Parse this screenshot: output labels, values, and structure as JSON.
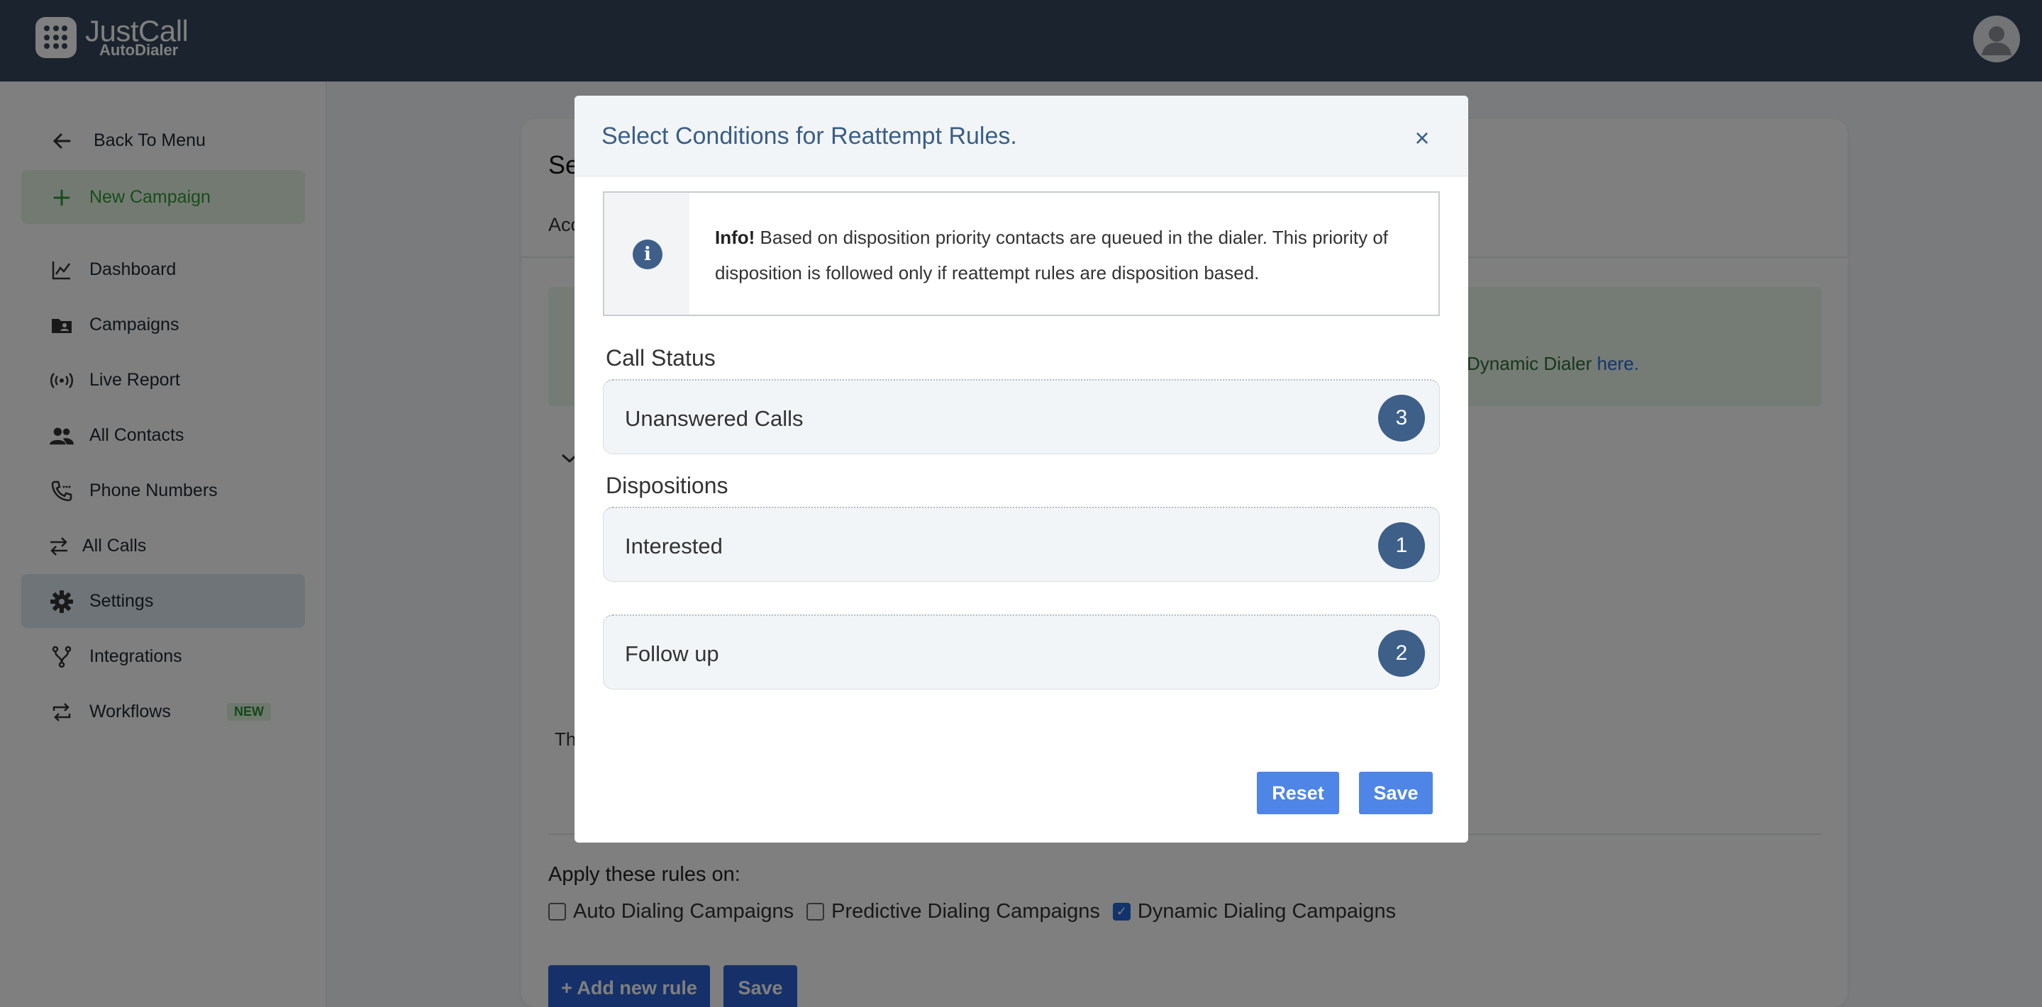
{
  "header": {
    "brand_name": "JustCall",
    "brand_sub": "AutoDialer"
  },
  "sidebar": {
    "back_label": "Back To Menu",
    "new_campaign_label": "New Campaign",
    "items": [
      {
        "label": "Dashboard"
      },
      {
        "label": "Campaigns"
      },
      {
        "label": "Live Report"
      },
      {
        "label": "All Contacts"
      },
      {
        "label": "Phone Numbers"
      },
      {
        "label": "All Calls"
      },
      {
        "label": "Settings"
      },
      {
        "label": "Integrations"
      },
      {
        "label": "Workflows",
        "badge": "NEW"
      }
    ]
  },
  "background": {
    "title_partial": "Se",
    "tab_partial": "Acc",
    "green_text": "Dynamic Dialer ",
    "green_link": "here.",
    "partial_text": "Th",
    "apply_label": "Apply these rules on:",
    "checkboxes": [
      {
        "label": "Auto Dialing Campaigns",
        "checked": false
      },
      {
        "label": "Predictive Dialing Campaigns",
        "checked": false
      },
      {
        "label": "Dynamic Dialing Campaigns",
        "checked": true
      }
    ],
    "add_rule_label": "+ Add new rule",
    "save_label": "Save"
  },
  "modal": {
    "title": "Select Conditions for Reattempt Rules.",
    "close_symbol": "×",
    "info_bold": "Info!",
    "info_text": " Based on disposition priority contacts are queued in the dialer. This priority of disposition is followed only if reattempt rules are disposition based.",
    "call_status_label": "Call Status",
    "call_status_items": [
      {
        "label": "Unanswered Calls",
        "count": "3"
      }
    ],
    "dispositions_label": "Dispositions",
    "disposition_items": [
      {
        "label": "Interested",
        "count": "1"
      },
      {
        "label": "Follow up",
        "count": "2"
      }
    ],
    "reset_label": "Reset",
    "save_label": "Save"
  },
  "colors": {
    "header_bg": "#36475c",
    "accent": "#3d5f88",
    "button": "#4f85e6",
    "new_campaign": "#2f9b35"
  }
}
